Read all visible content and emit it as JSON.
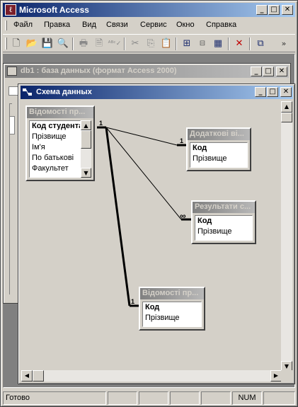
{
  "app": {
    "title": "Microsoft Access",
    "icon": "access-key-icon"
  },
  "menu": [
    "Файл",
    "Правка",
    "Вид",
    "Связи",
    "Сервис",
    "Окно",
    "Справка"
  ],
  "toolbar": {
    "icons": [
      "new-icon",
      "open-icon",
      "save-icon",
      "search-icon",
      "print-icon",
      "print-preview-icon",
      "spelling-icon",
      "cut-icon",
      "copy-icon",
      "paste-icon",
      "show-table-icon",
      "direct-relationships-icon",
      "all-relationships-icon",
      "delete-icon",
      "database-window-icon",
      "overflow-icon"
    ]
  },
  "db_window": {
    "title": "db1 : база данных (формат Access 2000)"
  },
  "relationships_window": {
    "title": "Схема данных"
  },
  "tables": [
    {
      "title": "Відомості пр...",
      "fields": [
        "Код студента",
        "Прізвище",
        "Ім'я",
        "По батькові",
        "Факультет"
      ],
      "key_index": 0,
      "has_scrollbar": true
    },
    {
      "title": "Додаткові ві...",
      "fields": [
        "Код",
        "Прізвище"
      ],
      "key_index": 0,
      "has_scrollbar": false
    },
    {
      "title": "Результати с...",
      "fields": [
        "Код",
        "Прізвище"
      ],
      "key_index": 0,
      "has_scrollbar": false
    },
    {
      "title": "Відомості пр...",
      "fields": [
        "Код",
        "Прізвище"
      ],
      "key_index": 0,
      "has_scrollbar": false
    }
  ],
  "relationships": [
    {
      "from_table": 0,
      "to_table": 1,
      "from_card": "1",
      "to_card": "1",
      "enforced": false
    },
    {
      "from_table": 0,
      "to_table": 2,
      "from_card": "",
      "to_card": "∞",
      "enforced": false
    },
    {
      "from_table": 0,
      "to_table": 3,
      "from_card": "",
      "to_card": "1",
      "enforced": true
    }
  ],
  "status": {
    "text": "Готово",
    "num": "NUM"
  },
  "colors": {
    "active_title_start": "#0a246a",
    "active_title_end": "#a6caf0",
    "inactive_title": "#808080",
    "face": "#d4d0c8"
  }
}
